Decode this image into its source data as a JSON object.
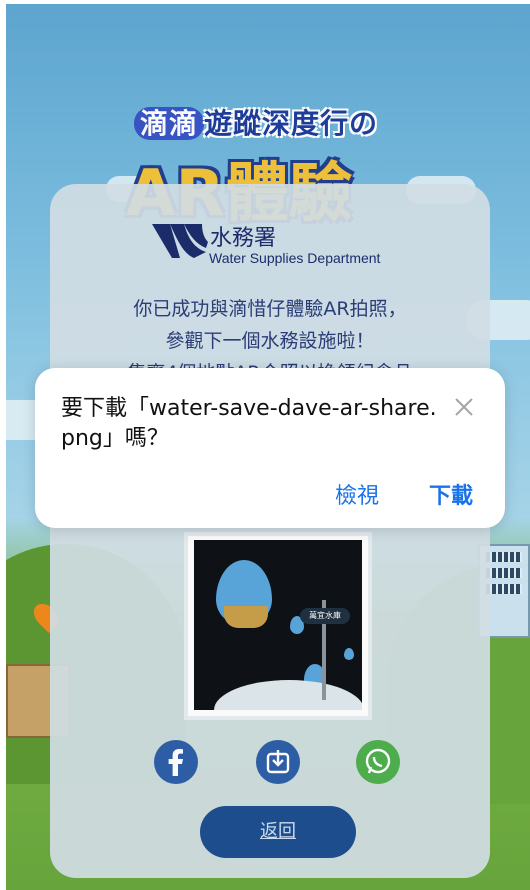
{
  "banner": {
    "title_highlight": "滴滴",
    "title_rest": "遊蹤深度行の",
    "big_text": "AR體驗"
  },
  "card": {
    "logo_cn": "水務署",
    "logo_en": "Water Supplies Department",
    "message_line1": "你已成功與滴惜仔體驗AR拍照，",
    "message_line2": "參觀下一個水務設施啦！",
    "message_line3": "集齊4個地點AR合照以換領紀念品",
    "photo_sign": "萬宜水庫",
    "back_label": "返回"
  },
  "share_icons": [
    "facebook-icon",
    "download-icon",
    "whatsapp-icon"
  ],
  "dialog": {
    "message": "要下載「water-save-dave-ar-share.png」嗎？",
    "view_label": "檢視",
    "download_label": "下載"
  },
  "colors": {
    "accent_blue": "#1a73e8",
    "brand_navy": "#1e4f8f",
    "whatsapp_green": "#4fb04d"
  }
}
